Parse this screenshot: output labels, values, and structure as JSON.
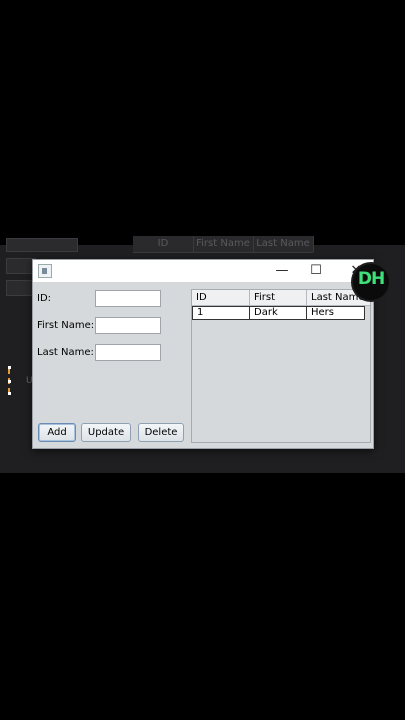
{
  "background": {
    "table_headers": [
      "ID",
      "First Name",
      "Last Name"
    ],
    "partial_text": "U"
  },
  "window": {
    "app_icon": "java-app-icon",
    "minimize": "—",
    "maximize": "☐",
    "close": "✕"
  },
  "form": {
    "id_label": "ID:",
    "first_name_label": "First Name:",
    "last_name_label": "Last Name:",
    "id_value": "",
    "first_name_value": "",
    "last_name_value": ""
  },
  "buttons": {
    "add": "Add",
    "update": "Update",
    "delete": "Delete"
  },
  "table": {
    "columns": [
      "ID",
      "First Name",
      "Last Name"
    ],
    "rows": [
      [
        "1",
        "Dark",
        "Hers"
      ]
    ]
  },
  "logo": {
    "text": "DH",
    "color": "#3ee07a"
  }
}
